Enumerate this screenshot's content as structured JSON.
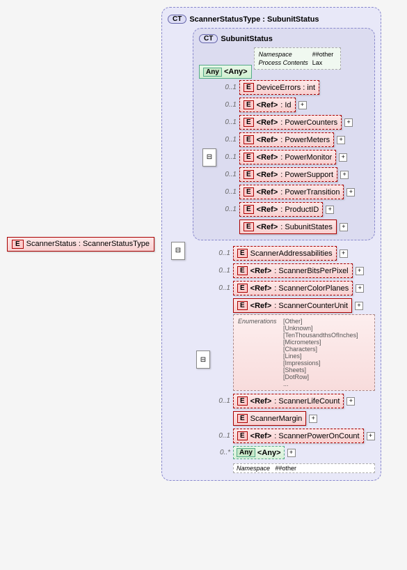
{
  "root": {
    "badge": "E",
    "label": "ScannerStatus : ScannerStatusType"
  },
  "ct_outer": {
    "badge": "CT",
    "title": "ScannerStatusType : SubunitStatus"
  },
  "ct_inner": {
    "badge": "CT",
    "title": "SubunitStatus"
  },
  "any_top": {
    "badge": "Any",
    "label": "<Any>",
    "detail_rows": [
      {
        "k": "Namespace",
        "v": "##other"
      },
      {
        "k": "Process Contents",
        "v": "Lax"
      }
    ]
  },
  "inner_items": [
    {
      "card": "0..1",
      "badge": "E",
      "label": "DeviceErrors : int",
      "dashed": true,
      "plus": false
    },
    {
      "card": "0..1",
      "badge": "E",
      "ref": "<Ref>",
      "label": ": Id",
      "dashed": true,
      "plus": true
    },
    {
      "card": "0..1",
      "badge": "E",
      "ref": "<Ref>",
      "label": ": PowerCounters",
      "dashed": true,
      "plus": true
    },
    {
      "card": "0..1",
      "badge": "E",
      "ref": "<Ref>",
      "label": ": PowerMeters",
      "dashed": true,
      "plus": true
    },
    {
      "card": "0..1",
      "badge": "E",
      "ref": "<Ref>",
      "label": ": PowerMonitor",
      "dashed": true,
      "plus": true
    },
    {
      "card": "0..1",
      "badge": "E",
      "ref": "<Ref>",
      "label": ": PowerSupport",
      "dashed": true,
      "plus": true
    },
    {
      "card": "0..1",
      "badge": "E",
      "ref": "<Ref>",
      "label": ": PowerTransition",
      "dashed": true,
      "plus": true
    },
    {
      "card": "0..1",
      "badge": "E",
      "ref": "<Ref>",
      "label": ": ProductID",
      "dashed": true,
      "plus": true
    },
    {
      "card": "",
      "badge": "E",
      "ref": "<Ref>",
      "label": ": SubunitStates",
      "dashed": false,
      "plus": true
    }
  ],
  "outer_items": [
    {
      "card": "0..1",
      "badge": "E",
      "label": "ScannerAddressabilities",
      "dashed": true,
      "plus": true
    },
    {
      "card": "0..1",
      "badge": "E",
      "ref": "<Ref>",
      "label": ": ScannerBitsPerPixel",
      "dashed": true,
      "plus": true
    },
    {
      "card": "0..1",
      "badge": "E",
      "ref": "<Ref>",
      "label": ": ScannerColorPlanes",
      "dashed": true,
      "plus": true
    },
    {
      "card": "",
      "badge": "E",
      "ref": "<Ref>",
      "label": ": ScannerCounterUnit",
      "dashed": false,
      "plus": true,
      "enum": {
        "title": "Enumerations",
        "values": [
          "[Other]",
          "[Unknown]",
          "[TenThousandthsOfInches]",
          "[Micrometers]",
          "[Characters]",
          "[Lines]",
          "[Impressions]",
          "[Sheets]",
          "[DotRow]",
          "..."
        ]
      }
    },
    {
      "card": "0..1",
      "badge": "E",
      "ref": "<Ref>",
      "label": ": ScannerLifeCount",
      "dashed": true,
      "plus": true
    },
    {
      "card": "",
      "badge": "E",
      "label": "ScannerMargin",
      "dashed": false,
      "plus": true
    },
    {
      "card": "0..1",
      "badge": "E",
      "ref": "<Ref>",
      "label": ": ScannerPowerOnCount",
      "dashed": true,
      "plus": true
    }
  ],
  "any_bottom": {
    "card": "0..*",
    "badge": "Any",
    "label": "<Any>",
    "ns_label": "Namespace",
    "ns_value": "##other"
  },
  "sequence_icon": "⊟"
}
